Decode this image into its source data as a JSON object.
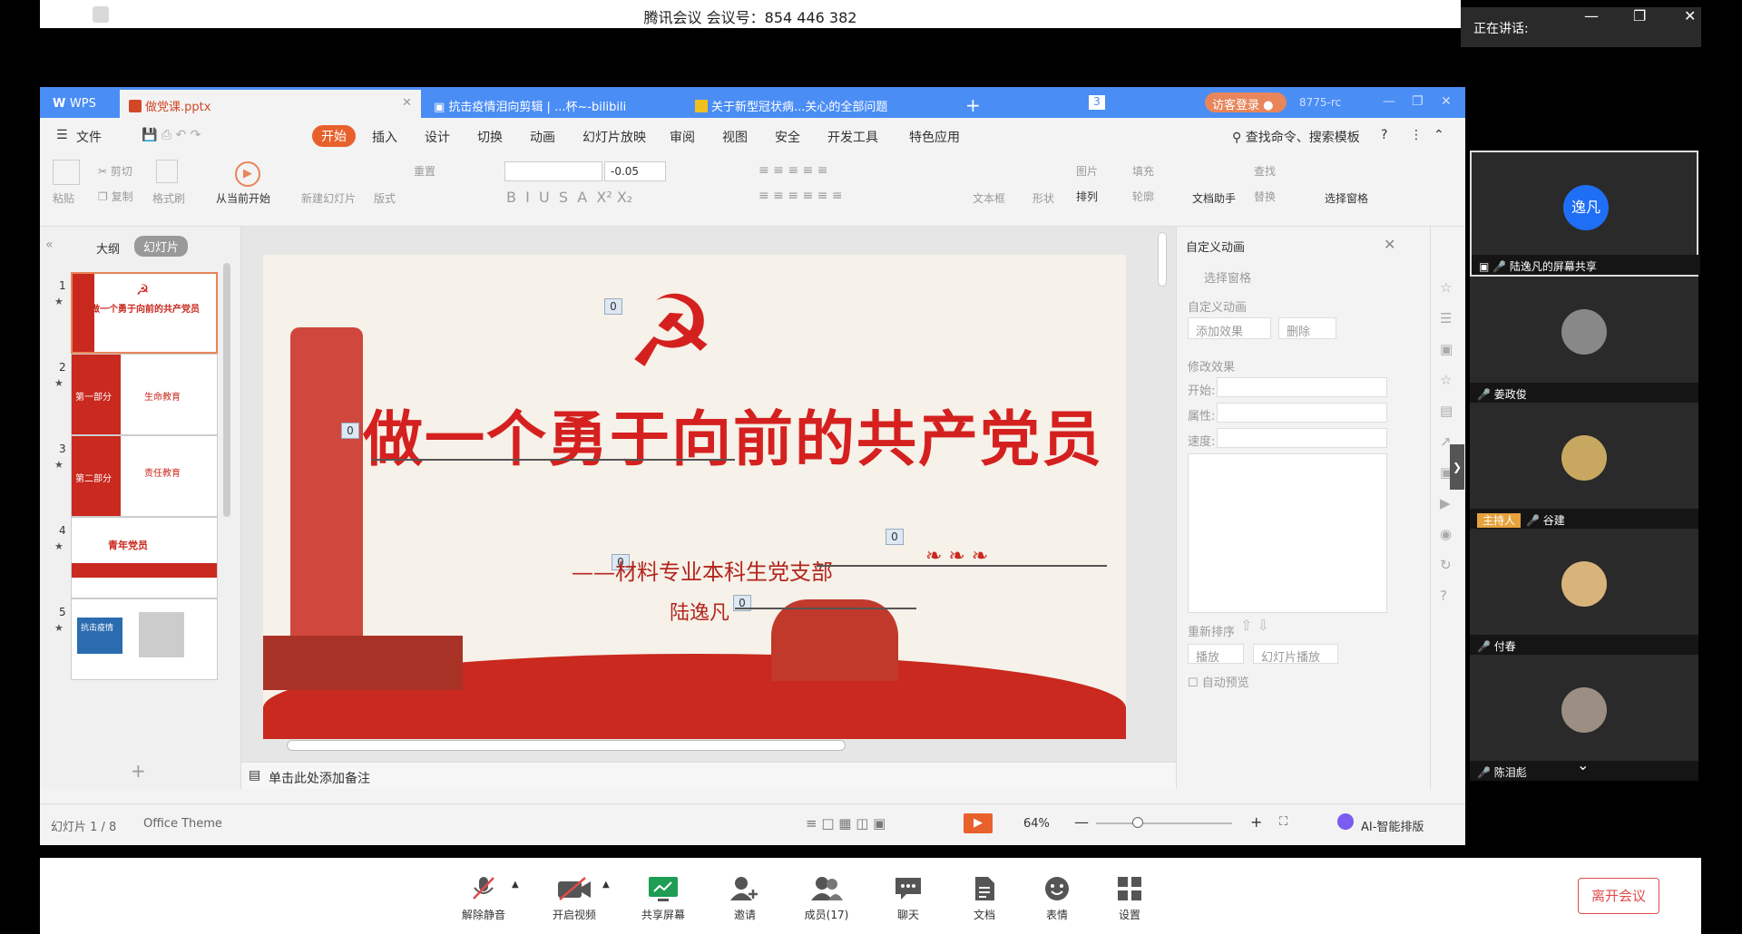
{
  "meeting": {
    "title": "腾讯会议 会议号：854 446 382",
    "speaking_label": "正在讲话:",
    "bottom_bar": [
      {
        "label": "解除静音",
        "icon": "mic-muted-icon"
      },
      {
        "label": "开启视频",
        "icon": "camera-off-icon"
      },
      {
        "label": "共享屏幕",
        "icon": "share-screen-icon"
      },
      {
        "label": "邀请",
        "icon": "invite-user-icon"
      },
      {
        "label": "成员(17)",
        "icon": "members-icon"
      },
      {
        "label": "聊天",
        "icon": "chat-icon"
      },
      {
        "label": "文档",
        "icon": "document-icon"
      },
      {
        "label": "表情",
        "icon": "emoji-icon"
      },
      {
        "label": "设置",
        "icon": "settings-grid-icon"
      }
    ],
    "leave_label": "离开会议",
    "participants": [
      {
        "name": "陆逸凡的屏幕共享",
        "avatar_text": "逸凡",
        "host": ""
      },
      {
        "name": "姜政俊",
        "avatar_text": "",
        "host": ""
      },
      {
        "name": "谷建",
        "avatar_text": "",
        "host": "主持人"
      },
      {
        "name": "付春",
        "avatar_text": "",
        "host": ""
      },
      {
        "name": "陈泪彪",
        "avatar_text": "",
        "host": ""
      }
    ]
  },
  "wps": {
    "tabs": [
      "WPS",
      "做党课.pptx",
      "抗击疫情泪向剪辑 | ...杯~-bilibili",
      "关于新型冠状病...关心的全部问题",
      "+"
    ],
    "badge": "3",
    "login_label": "访客登录",
    "account_id": "8775-rc",
    "menus": [
      "文件",
      "开始",
      "插入",
      "设计",
      "切换",
      "动画",
      "幻灯片放映",
      "审阅",
      "视图",
      "安全",
      "开发工具",
      "特色应用"
    ],
    "search_label": "查找命令、搜索模板",
    "ribbon": {
      "paste": "粘贴",
      "cut": "剪切",
      "copy": "复制",
      "format_painter": "格式刷",
      "from_current": "从当前开始",
      "new_slide": "新建幻灯片",
      "layout": "版式",
      "reset": "重置",
      "font_size_value": "-0.05",
      "text_box": "文本框",
      "shape": "形状",
      "picture": "图片",
      "fill": "填充",
      "arrange": "排列",
      "outline": "轮廓",
      "doc_helper": "文档助手",
      "find": "查找",
      "replace": "替换",
      "select_pane": "选择窗格"
    },
    "left_tabs": {
      "outline": "大纲",
      "slides": "幻灯片"
    },
    "thumbnails": [
      {
        "num": "1",
        "text": "做一个勇于向前的共产党员"
      },
      {
        "num": "2",
        "text": "第一部分",
        "text2": "生命教育"
      },
      {
        "num": "3",
        "text": "第二部分",
        "text2": "责任教育"
      },
      {
        "num": "4",
        "text": "青年党员"
      },
      {
        "num": "5",
        "text": "抗击疫情"
      }
    ],
    "slide": {
      "title": "做一个勇于向前的共产党员",
      "subtitle": "——材料专业本科生党支部",
      "author": "陆逸凡",
      "anim_tag": "0"
    },
    "anim_panel": {
      "header": "自定义动画",
      "select_pane": "选择窗格",
      "section": "自定义动画",
      "add_effect": "添加效果",
      "delete": "删除",
      "modify": "修改效果",
      "start": "开始:",
      "property": "属性:",
      "speed": "速度:",
      "reorder": "重新排序",
      "play": "播放",
      "slideshow": "幻灯片播放",
      "auto_preview": "自动预览"
    },
    "notes_placeholder": "单击此处添加备注",
    "status": {
      "slide_info": "幻灯片 1 / 8",
      "theme": "Office Theme",
      "zoom": "64%",
      "ai_label": "AI-智能排版"
    }
  },
  "colors": {
    "accent": "#e8612c",
    "tabbar": "#4a8df5",
    "party_red": "#d4211f",
    "leave_red": "#e04b4b"
  }
}
